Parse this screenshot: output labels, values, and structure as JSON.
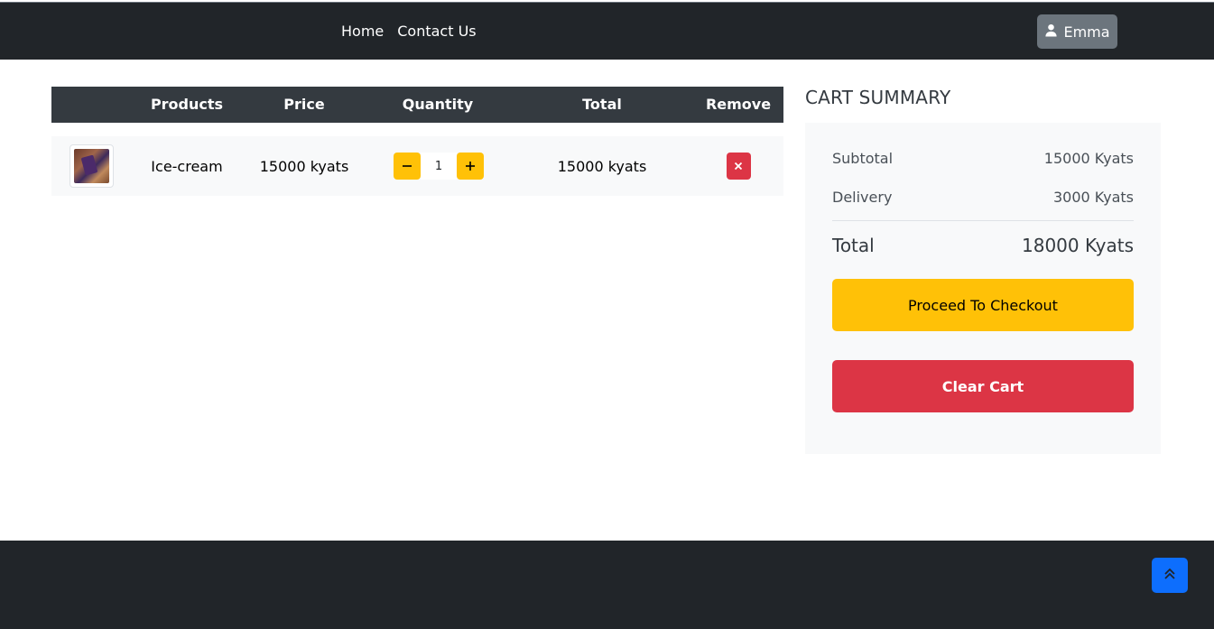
{
  "nav": {
    "links": [
      {
        "label": "Home"
      },
      {
        "label": "Contact Us"
      }
    ],
    "user_label": "Emma"
  },
  "cart": {
    "headers": {
      "products": "Products",
      "price": "Price",
      "quantity": "Quantity",
      "total": "Total",
      "remove": "Remove"
    },
    "items": [
      {
        "name": "Ice-cream",
        "price": "15000 kyats",
        "quantity": "1",
        "total": "15000 kyats",
        "decrement_icon": "minus-icon",
        "increment_icon": "plus-icon",
        "remove_icon": "close-icon"
      }
    ]
  },
  "summary": {
    "title": "CART SUMMARY",
    "subtotal_label": "Subtotal",
    "subtotal_value": "15000 Kyats",
    "delivery_label": "Delivery",
    "delivery_value": "3000 Kyats",
    "total_label": "Total",
    "total_value": "18000 Kyats",
    "checkout_label": "Proceed To Checkout",
    "clear_label": "Clear Cart"
  },
  "footer": {
    "scroll_top_icon": "double-chevron-up-icon"
  },
  "colors": {
    "navbar": "#212529",
    "table_header": "#343a40",
    "warning": "#ffc107",
    "danger": "#dc3545",
    "primary": "#0d6efd",
    "secondary": "#6c757d"
  }
}
